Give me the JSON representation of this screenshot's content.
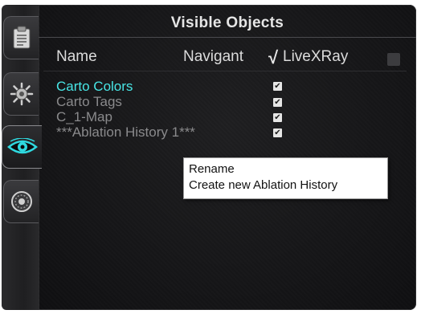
{
  "panel": {
    "title": "Visible Objects",
    "columns": {
      "name": "Name",
      "navigant": "Navigant",
      "livexray_check": "√",
      "livexray": "LiveXRay"
    }
  },
  "objects": [
    {
      "name": "Carto Colors",
      "checked": true,
      "color": "#48e6e6"
    },
    {
      "name": "Carto Tags",
      "checked": true,
      "color": "#8a8a8c"
    },
    {
      "name": "C_1-Map",
      "checked": true,
      "color": "#8a8a8c"
    },
    {
      "name": "***Ablation History 1***",
      "checked": true,
      "color": "#8a8a8c"
    }
  ],
  "checkmark": "✔",
  "context_menu": {
    "items": [
      "Rename",
      "Create new Ablation History"
    ]
  },
  "tabs": [
    {
      "icon": "clipboard-icon",
      "active": false
    },
    {
      "icon": "gear-wheel-icon",
      "active": false
    },
    {
      "icon": "eye-icon",
      "active": true
    },
    {
      "icon": "dial-icon",
      "active": false
    }
  ],
  "colors": {
    "accent": "#48e6e6",
    "panel_bg": "#141416",
    "text": "#dcdcdc",
    "dim_text": "#8a8a8c"
  }
}
